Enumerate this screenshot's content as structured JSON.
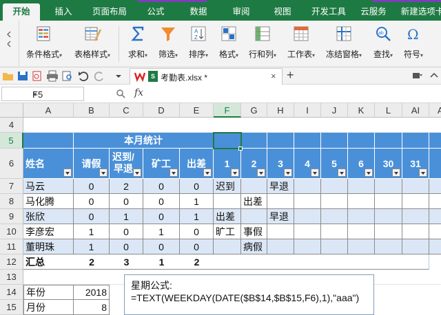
{
  "ribbon_tabs": [
    {
      "label": "开始",
      "active": true
    },
    {
      "label": "插入"
    },
    {
      "label": "页面布局"
    },
    {
      "label": "公式"
    },
    {
      "label": "数据"
    },
    {
      "label": "审阅"
    },
    {
      "label": "视图"
    },
    {
      "label": "开发工具"
    },
    {
      "label": "云服务"
    },
    {
      "label": "新建选项卡"
    }
  ],
  "ribbon_buttons": [
    {
      "label": "条件格式",
      "icon": "conditional-format-icon"
    },
    {
      "label": "表格样式",
      "icon": "table-style-icon"
    },
    {
      "label": "求和",
      "icon": "sum-icon"
    },
    {
      "label": "筛选",
      "icon": "filter-icon"
    },
    {
      "label": "排序",
      "icon": "sort-icon"
    },
    {
      "label": "格式",
      "icon": "format-icon"
    },
    {
      "label": "行和列",
      "icon": "rows-cols-icon"
    },
    {
      "label": "工作表",
      "icon": "worksheet-icon"
    },
    {
      "label": "冻结窗格",
      "icon": "freeze-panes-icon"
    },
    {
      "label": "查找",
      "icon": "find-icon"
    },
    {
      "label": "符号",
      "icon": "symbol-icon"
    }
  ],
  "document": {
    "filename": "考勤表.xlsx *",
    "close": "×",
    "add": "+"
  },
  "formula_bar": {
    "name_box": "F5",
    "fx": "fx",
    "formula": ""
  },
  "colors": {
    "brand_green": "#1e7a43",
    "header_blue": "#4a90d9",
    "band_blue": "#dbe7f6"
  },
  "sheet": {
    "columns": [
      "A",
      "B",
      "C",
      "D",
      "E",
      "F",
      "G",
      "H",
      "I",
      "J",
      "K",
      "L",
      "AI",
      "AJ"
    ],
    "selected_col": "F",
    "row_numbers": [
      "4",
      "5",
      "6",
      "7",
      "8",
      "9",
      "10",
      "11",
      "12",
      "13",
      "14",
      "15"
    ],
    "selected_row": "5",
    "title": "本月统计",
    "headers": [
      "姓名",
      "请假",
      "迟到/早退",
      "矿工",
      "出差",
      "1",
      "2",
      "3",
      "4",
      "5",
      "6",
      "30",
      "31"
    ],
    "rows": [
      {
        "name": "马云",
        "leave": "0",
        "late": "2",
        "absent": "0",
        "trip": "0",
        "days": [
          "迟到",
          "",
          "早退",
          "",
          "",
          "",
          "",
          ""
        ]
      },
      {
        "name": "马化腾",
        "leave": "0",
        "late": "0",
        "absent": "0",
        "trip": "1",
        "days": [
          "",
          "出差",
          "",
          "",
          "",
          "",
          "",
          ""
        ]
      },
      {
        "name": "张欣",
        "leave": "0",
        "late": "1",
        "absent": "0",
        "trip": "1",
        "days": [
          "出差",
          "",
          "早退",
          "",
          "",
          "",
          "",
          ""
        ]
      },
      {
        "name": "李彦宏",
        "leave": "1",
        "late": "0",
        "absent": "1",
        "trip": "0",
        "days": [
          "旷工",
          "事假",
          "",
          "",
          "",
          "",
          "",
          ""
        ]
      },
      {
        "name": "董明珠",
        "leave": "1",
        "late": "0",
        "absent": "0",
        "trip": "0",
        "days": [
          "",
          "病假",
          "",
          "",
          "",
          "",
          "",
          ""
        ]
      }
    ],
    "total": {
      "label": "汇总",
      "leave": "2",
      "late": "3",
      "absent": "1",
      "trip": "2"
    },
    "year": {
      "label": "年份",
      "value": "2018"
    },
    "month": {
      "label": "月份",
      "value": "8"
    }
  },
  "note": {
    "line1": "星期公式:",
    "line2": "=TEXT(WEEKDAY(DATE($B$14,$B$15,F6),1),\"aaa\")"
  }
}
